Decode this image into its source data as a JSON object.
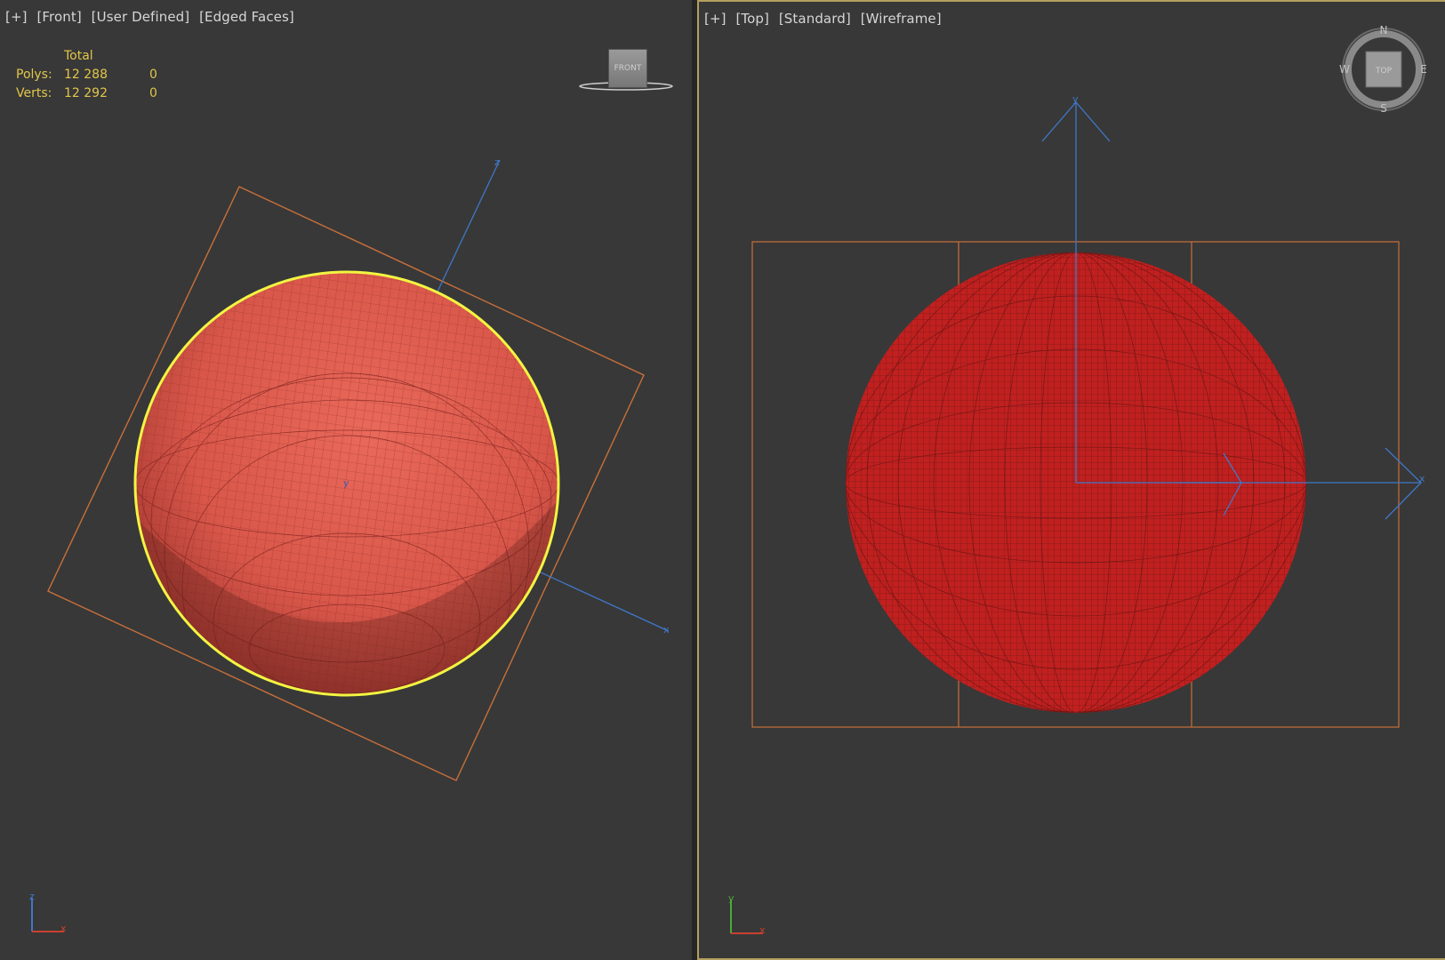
{
  "front_viewport": {
    "labels": [
      "[+]",
      "[Front]",
      "[User Defined]",
      "[Edged Faces]"
    ],
    "stats": {
      "header": "Total",
      "rows": [
        {
          "label": "Polys:",
          "total": "12 288",
          "selected": "0"
        },
        {
          "label": "Verts:",
          "total": "12 292",
          "selected": "0"
        }
      ]
    },
    "nav_cube_label": "FRONT",
    "gizmo_axes": {
      "z": "z",
      "x": "x"
    },
    "corner_axes": {
      "up": "z",
      "right": "x"
    }
  },
  "top_viewport": {
    "labels": [
      "[+]",
      "[Top]",
      "[Standard]",
      "[Wireframe]"
    ],
    "nav_cube_label": "TOP",
    "compass": {
      "n": "N",
      "s": "S",
      "e": "E",
      "w": "W"
    },
    "gizmo_axes": {
      "y": "y",
      "x": "x"
    },
    "corner_axes": {
      "up": "y",
      "right": "x"
    }
  },
  "colors": {
    "viewport_bg": "#383838",
    "active_border": "#b3a060",
    "stats_text": "#e3c64a",
    "selection_outline": "#f2f542",
    "bbox": "#c8703a",
    "axis": "#3f77c8",
    "sphere_shaded": "#d9574a",
    "wire": "#c0201f"
  }
}
